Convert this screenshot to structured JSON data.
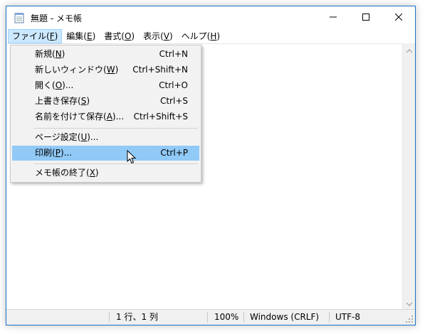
{
  "window": {
    "title": "無題 - メモ帳",
    "icon": "notepad-icon",
    "controls": [
      "minimize-icon",
      "maximize-icon",
      "close-icon"
    ]
  },
  "menubar": {
    "items": [
      {
        "label": "ファイル(",
        "key": "F",
        "suffix": ")"
      },
      {
        "label": "編集(",
        "key": "E",
        "suffix": ")"
      },
      {
        "label": "書式(",
        "key": "O",
        "suffix": ")"
      },
      {
        "label": "表示(",
        "key": "V",
        "suffix": ")"
      },
      {
        "label": "ヘルプ(",
        "key": "H",
        "suffix": ")"
      }
    ]
  },
  "file_menu": {
    "items": [
      {
        "label": "新規(",
        "key": "N",
        "suffix": ")",
        "shortcut": "Ctrl+N"
      },
      {
        "label": "新しいウィンドウ(",
        "key": "W",
        "suffix": ")",
        "shortcut": "Ctrl+Shift+N"
      },
      {
        "label": "開く(",
        "key": "O",
        "suffix": ")...",
        "shortcut": "Ctrl+O"
      },
      {
        "label": "上書き保存(",
        "key": "S",
        "suffix": ")",
        "shortcut": "Ctrl+S"
      },
      {
        "label": "名前を付けて保存(",
        "key": "A",
        "suffix": ")...",
        "shortcut": "Ctrl+Shift+S"
      },
      {
        "label": "ページ設定(",
        "key": "U",
        "suffix": ")...",
        "shortcut": ""
      },
      {
        "label": "印刷(",
        "key": "P",
        "suffix": ")...",
        "shortcut": "Ctrl+P"
      },
      {
        "label": "メモ帳の終了(",
        "key": "X",
        "suffix": ")",
        "shortcut": ""
      }
    ]
  },
  "statusbar": {
    "position": "1 行、1 列",
    "zoom": "100%",
    "line_ending": "Windows (CRLF)",
    "encoding": "UTF-8"
  },
  "colors": {
    "highlight": "#91c9f7",
    "menu_active": "#cce8ff",
    "window_border": "#1a73c7"
  }
}
